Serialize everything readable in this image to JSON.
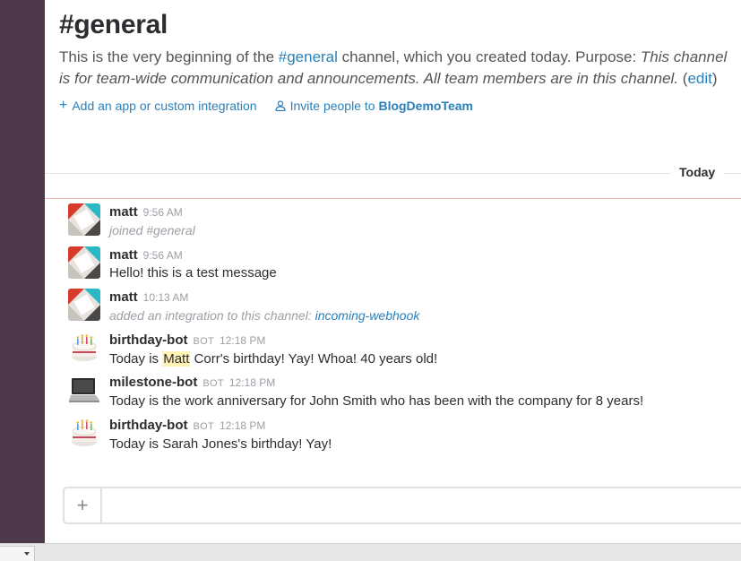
{
  "channel": {
    "title": "#general",
    "intro_prefix": "This is the very beginning of the ",
    "intro_channel": "#general",
    "intro_middle": " channel, which you created today. Purpose: ",
    "intro_purpose": "This channel is for team-wide communication and announcements. All team members are in this channel.",
    "intro_edit_open": " (",
    "intro_edit": "edit",
    "intro_edit_close": ")"
  },
  "actions": {
    "add_app": "Add an app or custom integration",
    "invite_prefix": "Invite people to ",
    "invite_team": "BlogDemoTeam"
  },
  "divider": {
    "label": "Today"
  },
  "messages": [
    {
      "sender": "matt",
      "bot": "",
      "time": "9:56 AM",
      "text": "joined #general",
      "avatar": "matt-avatar"
    },
    {
      "sender": "matt",
      "bot": "",
      "time": "9:56 AM",
      "text": "Hello! this is a test message",
      "avatar": "matt-avatar"
    },
    {
      "sender": "matt",
      "bot": "",
      "time": "10:13 AM",
      "text_prefix": "added an integration to this channel: ",
      "text_link": "incoming-webhook",
      "avatar": "matt-avatar"
    },
    {
      "sender": "birthday-bot",
      "bot": "BOT",
      "time": "12:18 PM",
      "text_prefix": "Today is ",
      "text_highlight": "Matt",
      "text_suffix": " Corr's birthday! Yay! Whoa! 40 years old!",
      "avatar": "birthday-cake-icon"
    },
    {
      "sender": "milestone-bot",
      "bot": "BOT",
      "time": "12:18 PM",
      "text": "Today is the work anniversary for John Smith who has been with the company for 8 years!",
      "avatar": "laptop-icon"
    },
    {
      "sender": "birthday-bot",
      "bot": "BOT",
      "time": "12:18 PM",
      "text": "Today is Sarah Jones's birthday! Yay!",
      "avatar": "birthday-cake-icon"
    }
  ],
  "composer": {
    "plus": "+",
    "placeholder": ""
  },
  "colors": {
    "sidebar": "#4d394b",
    "link": "#2a80b9",
    "highlight": "#fff3b5",
    "new_line": "#f0b7ae"
  }
}
